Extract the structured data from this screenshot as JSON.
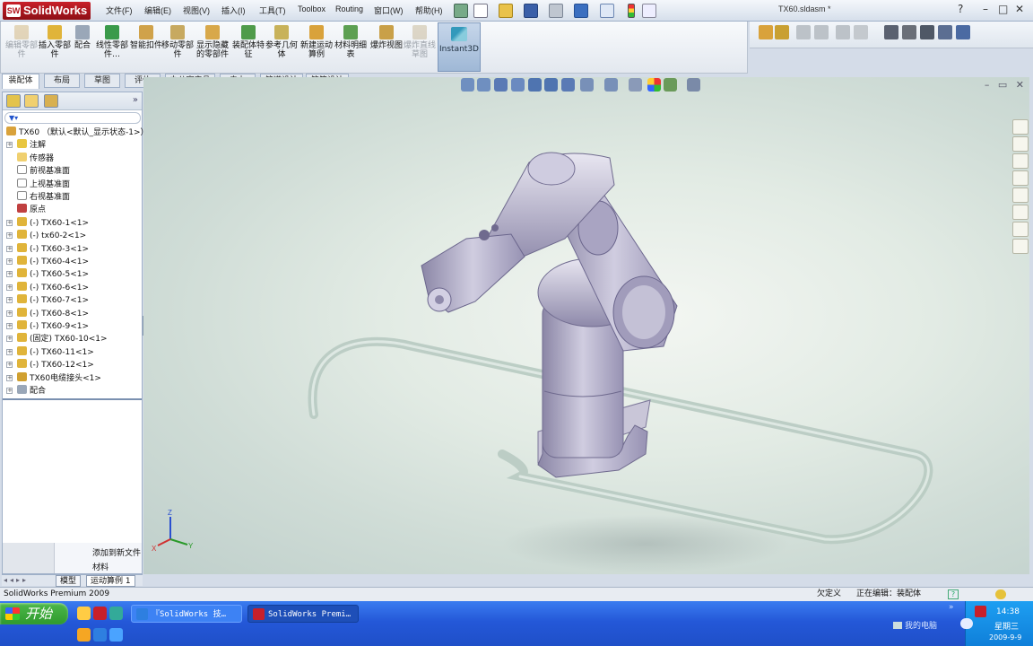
{
  "app": {
    "logo": "SolidWorks",
    "document_title": "TX60.sldasm *",
    "window_controls": [
      "?",
      "–",
      "□",
      "✕"
    ],
    "brand_color": "#b3141c"
  },
  "menu": [
    "文件(F)",
    "编辑(E)",
    "视图(V)",
    "插入(I)",
    "工具(T)",
    "Toolbox",
    "Routing",
    "窗口(W)",
    "帮助(H)"
  ],
  "command_manager": {
    "items": [
      {
        "label": "编辑零部件",
        "enabled": false,
        "icon": "edit-component-icon"
      },
      {
        "label": "插入零部件",
        "enabled": true,
        "icon": "insert-component-icon"
      },
      {
        "label": "配合",
        "enabled": true,
        "icon": "mate-icon"
      },
      {
        "label": "线性零部件…",
        "enabled": true,
        "icon": "linear-pattern-icon"
      },
      {
        "label": "智能扣件",
        "enabled": true,
        "icon": "smart-fastener-icon"
      },
      {
        "label": "移动零部件",
        "enabled": true,
        "icon": "move-component-icon"
      },
      {
        "label": "显示隐藏的零部件",
        "enabled": true,
        "icon": "show-hidden-icon"
      },
      {
        "label": "装配体特征",
        "enabled": true,
        "icon": "assembly-feature-icon"
      },
      {
        "label": "参考几何体",
        "enabled": true,
        "icon": "reference-geometry-icon"
      },
      {
        "label": "新建运动算例",
        "enabled": true,
        "icon": "new-motion-study-icon"
      },
      {
        "label": "材料明细表",
        "enabled": true,
        "icon": "bom-icon"
      },
      {
        "label": "爆炸视图",
        "enabled": true,
        "icon": "exploded-view-icon"
      },
      {
        "label": "爆炸直线草图",
        "enabled": false,
        "icon": "explode-line-sketch-icon"
      }
    ],
    "instant3d": "Instant3D"
  },
  "tabs": [
    "装配体",
    "布局",
    "草图",
    "评估",
    "办公室产品",
    "电力",
    "管道设计",
    "管筒设计"
  ],
  "tree": {
    "filter_symbol": "▼▾",
    "root": "TX60 （默认<默认_显示状态-1>）",
    "items": [
      {
        "label": "注解",
        "icon": "annotation-icon",
        "expandable": true
      },
      {
        "label": "传感器",
        "icon": "sensor-icon",
        "expandable": false
      },
      {
        "label": "前视基准面",
        "icon": "plane-icon",
        "expandable": false
      },
      {
        "label": "上视基准面",
        "icon": "plane-icon",
        "expandable": false
      },
      {
        "label": "右视基准面",
        "icon": "plane-icon",
        "expandable": false
      },
      {
        "label": "原点",
        "icon": "origin-icon",
        "expandable": false
      },
      {
        "label": "(-) TX60-1<1>",
        "icon": "part-icon",
        "expandable": true
      },
      {
        "label": "(-) tx60-2<1>",
        "icon": "part-icon",
        "expandable": true
      },
      {
        "label": "(-) TX60-3<1>",
        "icon": "part-icon",
        "expandable": true
      },
      {
        "label": "(-) TX60-4<1>",
        "icon": "part-icon",
        "expandable": true
      },
      {
        "label": "(-) TX60-5<1>",
        "icon": "part-icon",
        "expandable": true
      },
      {
        "label": "(-) TX60-6<1>",
        "icon": "part-icon",
        "expandable": true
      },
      {
        "label": "(-) TX60-7<1>",
        "icon": "part-icon",
        "expandable": true
      },
      {
        "label": "(-) TX60-8<1>",
        "icon": "part-icon",
        "expandable": true
      },
      {
        "label": "(-) TX60-9<1>",
        "icon": "part-icon",
        "expandable": true
      },
      {
        "label": "(固定) TX60-10<1>",
        "icon": "part-icon",
        "expandable": true
      },
      {
        "label": "(-) TX60-11<1>",
        "icon": "part-icon",
        "expandable": true
      },
      {
        "label": "(-) TX60-12<1>",
        "icon": "part-icon",
        "expandable": true
      },
      {
        "label": "TX60电缆接头<1>",
        "icon": "subassembly-icon",
        "expandable": true
      },
      {
        "label": "配合",
        "icon": "mates-folder-icon",
        "expandable": true
      }
    ],
    "bottom_items": [
      "添加到新文件",
      "材料"
    ]
  },
  "model_tabs": [
    "模型",
    "运动算例 1"
  ],
  "triad_labels": {
    "x": "X",
    "y": "Y",
    "z": "Z"
  },
  "status": {
    "left": "SolidWorks Premium 2009",
    "undefined": "欠定义",
    "editing": "正在编辑：装配体",
    "help": "?"
  },
  "taskbar": {
    "start": "开始",
    "tasks": [
      "『SolidWorks 技…",
      "SolidWorks Premi…"
    ],
    "my_computer": "我的电脑",
    "time": "14:38",
    "weekday": "星期三",
    "date": "2009-9-9"
  }
}
